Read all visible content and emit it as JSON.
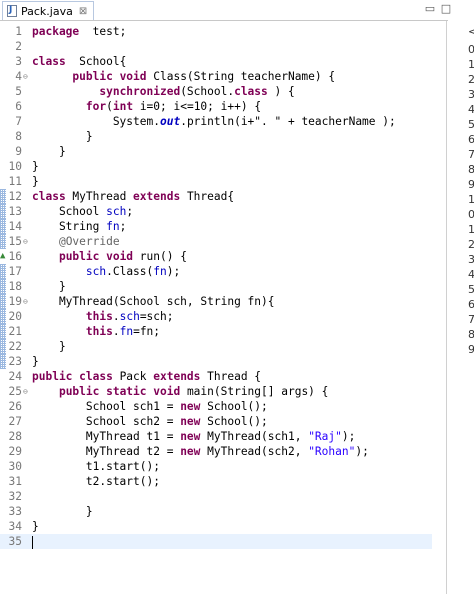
{
  "tab": {
    "title": "Pack.java",
    "close": "⊠"
  },
  "window": {
    "minimize": "▭",
    "maximize": "□"
  },
  "lines": [
    {
      "n": "1",
      "fold": "",
      "gutter": "",
      "tokens": [
        [
          "kw",
          "package"
        ],
        [
          "",
          "  test;"
        ]
      ]
    },
    {
      "n": "2",
      "fold": "",
      "gutter": "",
      "tokens": []
    },
    {
      "n": "3",
      "fold": "",
      "gutter": "",
      "tokens": [
        [
          "kw",
          "class"
        ],
        [
          "",
          "  School{"
        ]
      ]
    },
    {
      "n": "4",
      "fold": "⊖",
      "gutter": "",
      "tokens": [
        [
          "",
          "      "
        ],
        [
          "kw",
          "public void"
        ],
        [
          "",
          " Class(String teacherName) {"
        ]
      ]
    },
    {
      "n": "5",
      "fold": "",
      "gutter": "",
      "tokens": [
        [
          "",
          "          "
        ],
        [
          "kw",
          "synchronized"
        ],
        [
          "",
          "(School."
        ],
        [
          "kw",
          "class"
        ],
        [
          "",
          " ) {"
        ]
      ]
    },
    {
      "n": "6",
      "fold": "",
      "gutter": "",
      "tokens": [
        [
          "",
          "        "
        ],
        [
          "kw",
          "for"
        ],
        [
          "",
          "("
        ],
        [
          "kw",
          "int"
        ],
        [
          "",
          " i=0; i<=10; i++) {"
        ]
      ]
    },
    {
      "n": "7",
      "fold": "",
      "gutter": "",
      "tokens": [
        [
          "",
          "            System."
        ],
        [
          "sfld",
          "out"
        ],
        [
          "",
          ".println(i+\". \" + teacherName );"
        ]
      ]
    },
    {
      "n": "8",
      "fold": "",
      "gutter": "",
      "tokens": [
        [
          "",
          "        }"
        ]
      ]
    },
    {
      "n": "9",
      "fold": "",
      "gutter": "",
      "tokens": [
        [
          "",
          "    }"
        ]
      ]
    },
    {
      "n": "10",
      "fold": "",
      "gutter": "",
      "tokens": [
        [
          "",
          "}"
        ]
      ]
    },
    {
      "n": "11",
      "fold": "",
      "gutter": "",
      "tokens": [
        [
          "",
          "}"
        ]
      ]
    },
    {
      "n": "12",
      "fold": "",
      "gutter": "dotted",
      "tokens": [
        [
          "kw",
          "class"
        ],
        [
          "",
          " MyThread "
        ],
        [
          "kw",
          "extends"
        ],
        [
          "",
          " Thread{"
        ]
      ]
    },
    {
      "n": "13",
      "fold": "",
      "gutter": "dotted",
      "tokens": [
        [
          "",
          "    School "
        ],
        [
          "fld",
          "sch"
        ],
        [
          "",
          ";"
        ]
      ]
    },
    {
      "n": "14",
      "fold": "",
      "gutter": "dotted",
      "tokens": [
        [
          "",
          "    String "
        ],
        [
          "fld",
          "fn"
        ],
        [
          "",
          ";"
        ]
      ]
    },
    {
      "n": "15",
      "fold": "⊖",
      "gutter": "dotted",
      "tokens": [
        [
          "",
          "    "
        ],
        [
          "ann",
          "@Override"
        ]
      ]
    },
    {
      "n": "16",
      "fold": "",
      "gutter": "arrow",
      "tokens": [
        [
          "",
          "    "
        ],
        [
          "kw",
          "public void"
        ],
        [
          "",
          " run() {"
        ]
      ]
    },
    {
      "n": "17",
      "fold": "",
      "gutter": "dotted",
      "tokens": [
        [
          "",
          "        "
        ],
        [
          "fld",
          "sch"
        ],
        [
          "",
          ".Class("
        ],
        [
          "fld",
          "fn"
        ],
        [
          "",
          ");"
        ]
      ]
    },
    {
      "n": "18",
      "fold": "",
      "gutter": "dotted",
      "tokens": [
        [
          "",
          "    }"
        ]
      ]
    },
    {
      "n": "19",
      "fold": "⊖",
      "gutter": "dotted",
      "tokens": [
        [
          "",
          "    MyThread(School sch, String fn){"
        ]
      ]
    },
    {
      "n": "20",
      "fold": "",
      "gutter": "dotted",
      "tokens": [
        [
          "",
          "        "
        ],
        [
          "kw",
          "this"
        ],
        [
          "",
          "."
        ],
        [
          "fld",
          "sch"
        ],
        [
          "",
          "=sch;"
        ]
      ]
    },
    {
      "n": "21",
      "fold": "",
      "gutter": "dotted",
      "tokens": [
        [
          "",
          "        "
        ],
        [
          "kw",
          "this"
        ],
        [
          "",
          "."
        ],
        [
          "fld",
          "fn"
        ],
        [
          "",
          "=fn;"
        ]
      ]
    },
    {
      "n": "22",
      "fold": "",
      "gutter": "dotted",
      "tokens": [
        [
          "",
          "    }"
        ]
      ]
    },
    {
      "n": "23",
      "fold": "",
      "gutter": "dotted",
      "tokens": [
        [
          "",
          "}"
        ]
      ]
    },
    {
      "n": "24",
      "fold": "",
      "gutter": "",
      "tokens": [
        [
          "kw",
          "public class"
        ],
        [
          "",
          " Pack "
        ],
        [
          "kw",
          "extends"
        ],
        [
          "",
          " Thread {"
        ]
      ]
    },
    {
      "n": "25",
      "fold": "⊖",
      "gutter": "",
      "tokens": [
        [
          "",
          "    "
        ],
        [
          "kw",
          "public static void"
        ],
        [
          "",
          " main(String[] args) {"
        ]
      ]
    },
    {
      "n": "26",
      "fold": "",
      "gutter": "",
      "tokens": [
        [
          "",
          "        School sch1 = "
        ],
        [
          "kw",
          "new"
        ],
        [
          "",
          " School();"
        ]
      ]
    },
    {
      "n": "27",
      "fold": "",
      "gutter": "",
      "tokens": [
        [
          "",
          "        School sch2 = "
        ],
        [
          "kw",
          "new"
        ],
        [
          "",
          " School();"
        ]
      ]
    },
    {
      "n": "28",
      "fold": "",
      "gutter": "",
      "tokens": [
        [
          "",
          "        MyThread t1 = "
        ],
        [
          "kw",
          "new"
        ],
        [
          "",
          " MyThread(sch1, "
        ],
        [
          "str",
          "\"Raj\""
        ],
        [
          "",
          ");"
        ]
      ]
    },
    {
      "n": "29",
      "fold": "",
      "gutter": "",
      "tokens": [
        [
          "",
          "        MyThread t2 = "
        ],
        [
          "kw",
          "new"
        ],
        [
          "",
          " MyThread(sch2, "
        ],
        [
          "str",
          "\"Rohan\""
        ],
        [
          "",
          ");"
        ]
      ]
    },
    {
      "n": "30",
      "fold": "",
      "gutter": "",
      "tokens": [
        [
          "",
          "        t1.start();"
        ]
      ]
    },
    {
      "n": "31",
      "fold": "",
      "gutter": "",
      "tokens": [
        [
          "",
          "        t2.start();"
        ]
      ]
    },
    {
      "n": "32",
      "fold": "",
      "gutter": "",
      "tokens": []
    },
    {
      "n": "33",
      "fold": "",
      "gutter": "",
      "tokens": [
        [
          "",
          "        }"
        ]
      ]
    },
    {
      "n": "34",
      "fold": "",
      "gutter": "",
      "tokens": [
        [
          "",
          "}"
        ]
      ]
    },
    {
      "n": "35",
      "fold": "",
      "gutter": "",
      "tokens": [],
      "current": true
    }
  ],
  "side_panel": {
    "top_label": "<",
    "items": [
      "0",
      "1",
      "2",
      "3",
      "4",
      "5",
      "6",
      "7",
      "8",
      "9",
      "1",
      "0",
      "1",
      "2",
      "3",
      "4",
      "5",
      "6",
      "7",
      "8",
      "9"
    ]
  },
  "colors": {
    "keyword": "#7f0055",
    "field": "#0000c0",
    "string": "#2a00ff",
    "annotation": "#646464",
    "current_line": "#e8f2fe"
  }
}
